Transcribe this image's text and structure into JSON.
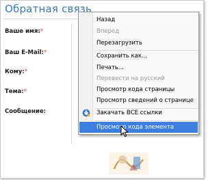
{
  "page": {
    "title": "Обратная связь",
    "form": {
      "labels": [
        {
          "text": "Ваше имя:",
          "required": "*"
        },
        {
          "text": "Ваш E-Mail:",
          "required": "*"
        },
        {
          "text": "Кому:",
          "required": "*"
        },
        {
          "text": "Тема:",
          "required": "*"
        },
        {
          "text": "Сообщение:",
          "required": ""
        }
      ]
    }
  },
  "context_menu": {
    "items": [
      {
        "label": "Назад",
        "disabled": false
      },
      {
        "label": "Вперед",
        "disabled": true
      },
      {
        "label": "Перезагрузить",
        "disabled": false
      },
      {
        "label": "Сохранить как...",
        "disabled": false
      },
      {
        "label": "Печать...",
        "disabled": false
      },
      {
        "label": "Перевести на русский",
        "disabled": true
      },
      {
        "label": "Просмотр кода страницы",
        "disabled": false
      },
      {
        "label": "Просмотр  сведений о странице",
        "disabled": false
      },
      {
        "label": "Закачать ВСЕ ссылки",
        "disabled": false,
        "icon": "download-manager-icon"
      },
      {
        "label": "Просмотр кода элемента",
        "disabled": false,
        "highlighted": true
      }
    ]
  },
  "colors": {
    "title": "#3b78b4",
    "required_mark": "#d13b3b",
    "menu_highlight": "#3d7fe0",
    "disabled_text": "#9a9a9a"
  }
}
